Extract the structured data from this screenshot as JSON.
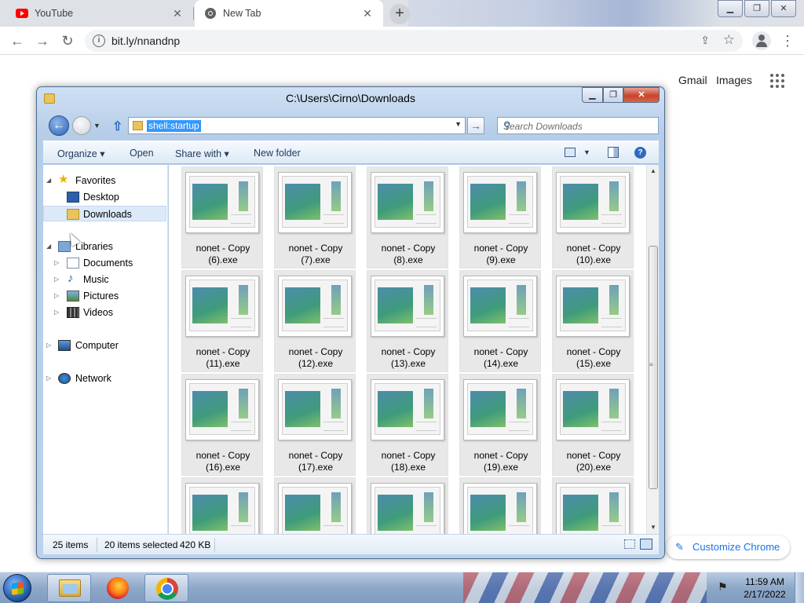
{
  "browser": {
    "tabs": [
      {
        "title": "YouTube",
        "icon": "youtube-icon",
        "active": false
      },
      {
        "title": "New Tab",
        "icon": "chrome-icon",
        "active": true
      }
    ],
    "url": "bit.ly/nnandnp",
    "links": {
      "gmail": "Gmail",
      "images": "Images"
    },
    "customize_label": "Customize Chrome"
  },
  "explorer": {
    "title": "C:\\Users\\Cirno\\Downloads",
    "address": "shell:startup",
    "search_placeholder": "Search Downloads",
    "commands": {
      "organize": "Organize",
      "open": "Open",
      "share_with": "Share with",
      "new_folder": "New folder"
    },
    "nav": {
      "favorites": "Favorites",
      "desktop": "Desktop",
      "downloads": "Downloads",
      "libraries": "Libraries",
      "documents": "Documents",
      "music": "Music",
      "pictures": "Pictures",
      "videos": "Videos",
      "computer": "Computer",
      "network": "Network"
    },
    "files": [
      {
        "line1": "nonet - Copy",
        "line2": "(6).exe"
      },
      {
        "line1": "nonet - Copy",
        "line2": "(7).exe"
      },
      {
        "line1": "nonet - Copy",
        "line2": "(8).exe"
      },
      {
        "line1": "nonet - Copy",
        "line2": "(9).exe"
      },
      {
        "line1": "nonet - Copy",
        "line2": "(10).exe"
      },
      {
        "line1": "nonet - Copy",
        "line2": "(11).exe"
      },
      {
        "line1": "nonet - Copy",
        "line2": "(12).exe"
      },
      {
        "line1": "nonet - Copy",
        "line2": "(13).exe"
      },
      {
        "line1": "nonet - Copy",
        "line2": "(14).exe"
      },
      {
        "line1": "nonet - Copy",
        "line2": "(15).exe"
      },
      {
        "line1": "nonet - Copy",
        "line2": "(16).exe"
      },
      {
        "line1": "nonet - Copy",
        "line2": "(17).exe"
      },
      {
        "line1": "nonet - Copy",
        "line2": "(18).exe"
      },
      {
        "line1": "nonet - Copy",
        "line2": "(19).exe"
      },
      {
        "line1": "nonet - Copy",
        "line2": "(20).exe"
      }
    ],
    "status": {
      "items": "25 items",
      "selected": "20 items selected",
      "size": "420 KB"
    }
  },
  "taskbar": {
    "time": "11:59 AM",
    "date": "2/17/2022"
  }
}
